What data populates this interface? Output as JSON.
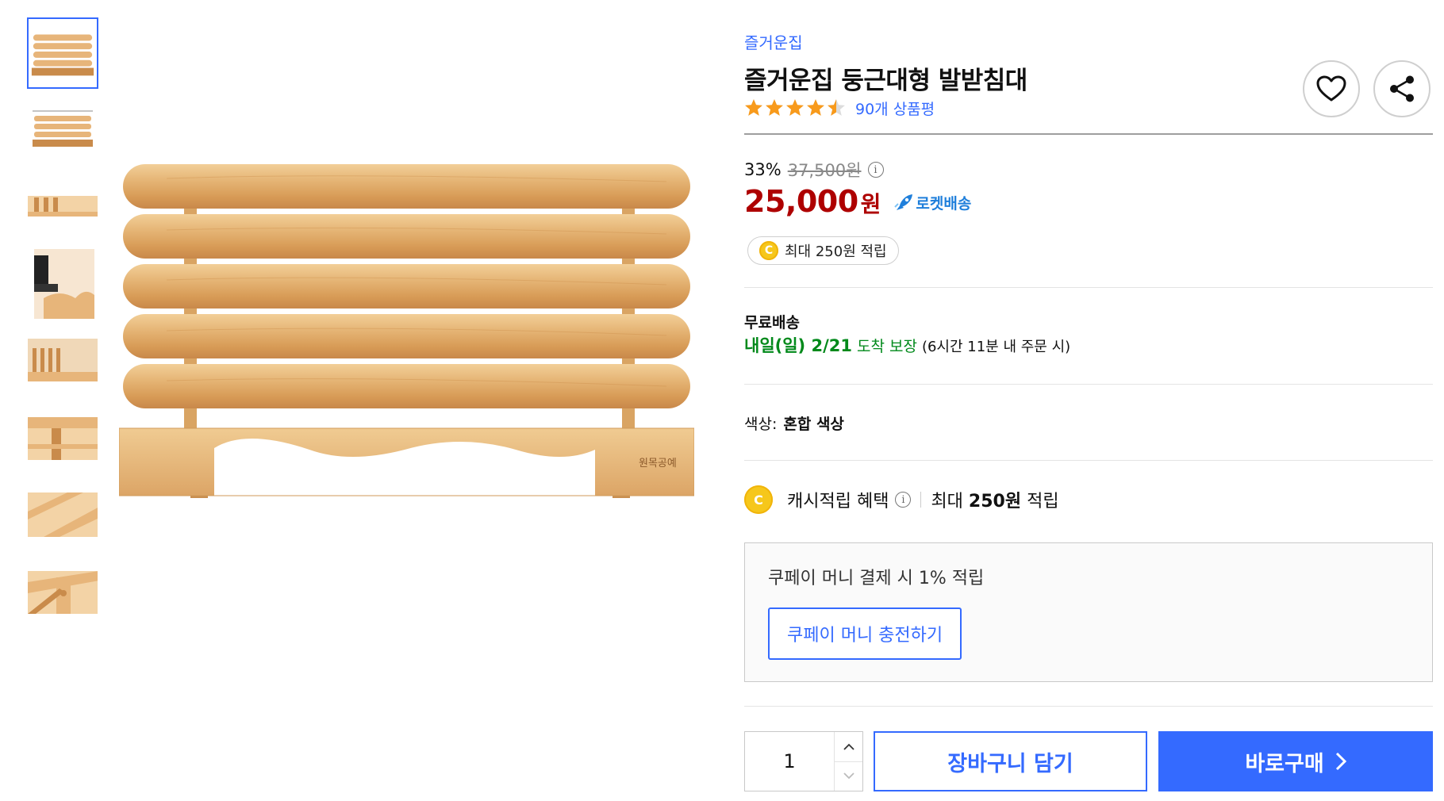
{
  "colors": {
    "accent": "#346aff",
    "price_red": "#ae0000",
    "delivery_green": "#00891a",
    "rocket_blue": "#1f7fdb",
    "star_orange": "#f89a1b",
    "coin_yellow": "#f6c71b"
  },
  "gallery": {
    "thumbnails": [
      {
        "icon": "bath-mat-front-thumb",
        "selected": true
      },
      {
        "icon": "bath-mat-dimension-thumb",
        "selected": false
      },
      {
        "icon": "bath-mat-side-thumb",
        "selected": false
      },
      {
        "icon": "bath-mat-foot-thumb",
        "selected": false
      },
      {
        "icon": "bath-mat-angle-thumb",
        "selected": false
      },
      {
        "icon": "bath-mat-joint-thumb",
        "selected": false
      },
      {
        "icon": "bath-mat-slats-thumb",
        "selected": false
      },
      {
        "icon": "bath-mat-peg-thumb",
        "selected": false
      }
    ],
    "main_image_icon": "wooden-bath-mat",
    "main_image_engraving": "원목공예"
  },
  "product": {
    "brand": "즐거운집",
    "title": "즐거운집 둥근대형 발받침대",
    "rating": 4.5,
    "review_count": "90개 상품평",
    "discount_rate": "33%",
    "original_price": "37,500원",
    "sale_price": "25,000",
    "sale_unit": "원",
    "rocket_label": "로켓배송",
    "cash_pill": "최대 250원 적립",
    "coin_symbol": "C"
  },
  "shipping": {
    "label": "무료배송",
    "date": "내일(일) 2/21",
    "guarantee": "도착 보장",
    "condition": "(6시간 11분 내 주문 시)"
  },
  "option": {
    "key": "색상:",
    "value": "혼합 색상"
  },
  "benefit": {
    "label": "캐시적립 혜택",
    "amount_prefix": "최대",
    "amount": "250원",
    "amount_suffix": "적립"
  },
  "money": {
    "text": "쿠페이 머니 결제 시 1% 적립",
    "charge_button": "쿠페이 머니 충전하기"
  },
  "purchase": {
    "quantity": "1",
    "cart_button": "장바구니 담기",
    "buy_button": "바로구매"
  }
}
